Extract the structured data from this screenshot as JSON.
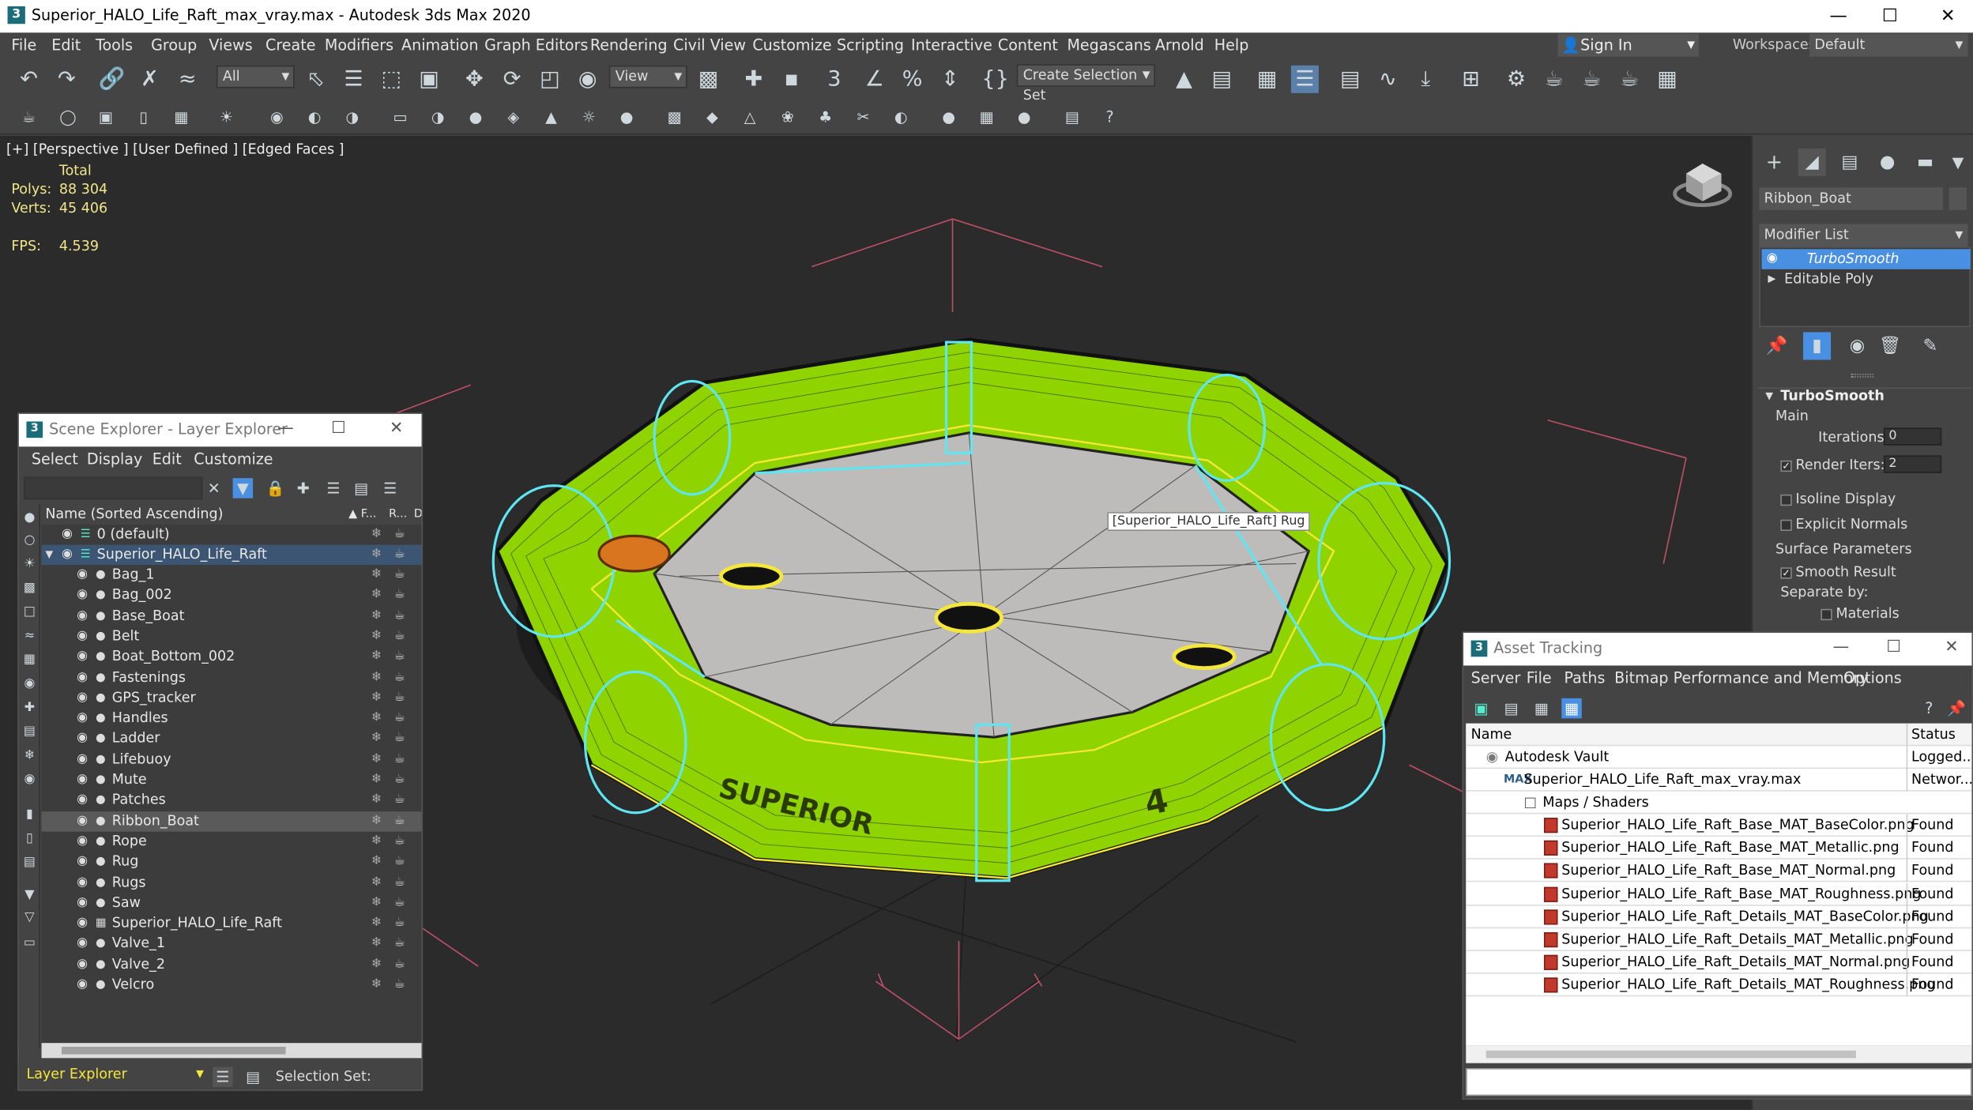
{
  "window": {
    "title": "Superior_HALO_Life_Raft_max_vray.max - Autodesk 3ds Max 2020",
    "app_icon": "3"
  },
  "menu": [
    "File",
    "Edit",
    "Tools",
    "Group",
    "Views",
    "Create",
    "Modifiers",
    "Animation",
    "Graph Editors",
    "Rendering",
    "Civil View",
    "Customize",
    "Scripting",
    "Interactive",
    "Content",
    "Megascans",
    "Arnold",
    "Help"
  ],
  "account": {
    "sign_in": "Sign In",
    "workspaces_label": "Workspaces:",
    "workspace": "Default"
  },
  "toolbar": {
    "selection_filter": "All",
    "ref_coord": "View",
    "selection_set": "Create Selection Set"
  },
  "viewport": {
    "label": "[+] [Perspective ] [User Defined ] [Edged Faces ]",
    "stats_header": "Total",
    "polys_label": "Polys:",
    "polys": "88 304",
    "verts_label": "Verts:",
    "verts": "45 406",
    "fps_label": "FPS:",
    "fps": "4.539",
    "tooltip": "[Superior_HALO_Life_Raft] Rug",
    "raft_text": "SUPERIOR",
    "raft_number": "4"
  },
  "command_panel": {
    "object_name": "Ribbon_Boat",
    "modifier_list": "Modifier List",
    "stack": [
      "TurboSmooth",
      "Editable Poly"
    ],
    "rollout_title": "TurboSmooth",
    "main_label": "Main",
    "iterations_label": "Iterations:",
    "iterations": "0",
    "render_iters_label": "Render Iters:",
    "render_iters": "2",
    "isoline": "Isoline Display",
    "explicit_normals": "Explicit Normals",
    "surface_params": "Surface Parameters",
    "smooth_result": "Smooth Result",
    "separate_by": "Separate by:",
    "materials": "Materials"
  },
  "scene_explorer": {
    "title": "Scene Explorer - Layer Explorer",
    "menu": [
      "Select",
      "Display",
      "Edit",
      "Customize"
    ],
    "col_name": "Name (Sorted Ascending)",
    "col_f": "▲ F...",
    "col_r": "R...",
    "col_d": "D",
    "layer_default": "0 (default)",
    "layer_main": "Superior_HALO_Life_Raft",
    "items": [
      "Bag_1",
      "Bag_002",
      "Base_Boat",
      "Belt",
      "Boat_Bottom_002",
      "Fastenings",
      "GPS_tracker",
      "Handles",
      "Ladder",
      "Lifebuoy",
      "Mute",
      "Patches",
      "Ribbon_Boat",
      "Rope",
      "Rug",
      "Rugs",
      "Saw",
      "Superior_HALO_Life_Raft",
      "Valve_1",
      "Valve_2",
      "Velcro"
    ],
    "footer_layer": "Layer Explorer",
    "footer_selset": "Selection Set:"
  },
  "asset_tracking": {
    "title": "Asset Tracking",
    "menu": [
      "Server",
      "File",
      "Paths",
      "Bitmap Performance and Memory",
      "Options"
    ],
    "col_name": "Name",
    "col_status": "Status",
    "vault": "Autodesk Vault",
    "vault_status": "Logged...",
    "file": "Superior_HALO_Life_Raft_max_vray.max",
    "file_status": "Networ...",
    "maps": "Maps / Shaders",
    "textures": [
      {
        "name": "Superior_HALO_Life_Raft_Base_MAT_BaseColor.png",
        "status": "Found"
      },
      {
        "name": "Superior_HALO_Life_Raft_Base_MAT_Metallic.png",
        "status": "Found"
      },
      {
        "name": "Superior_HALO_Life_Raft_Base_MAT_Normal.png",
        "status": "Found"
      },
      {
        "name": "Superior_HALO_Life_Raft_Base_MAT_Roughness.png",
        "status": "Found"
      },
      {
        "name": "Superior_HALO_Life_Raft_Details_MAT_BaseColor.png",
        "status": "Found"
      },
      {
        "name": "Superior_HALO_Life_Raft_Details_MAT_Metallic.png",
        "status": "Found"
      },
      {
        "name": "Superior_HALO_Life_Raft_Details_MAT_Normal.png",
        "status": "Found"
      },
      {
        "name": "Superior_HALO_Life_Raft_Details_MAT_Roughness.png",
        "status": "Found"
      }
    ]
  },
  "colors": {
    "accent": "#4a90e2",
    "raft": "#8fd400",
    "selection": "#5ee6f2",
    "highlight": "#f5e63a",
    "stats": "#f0e68c"
  }
}
